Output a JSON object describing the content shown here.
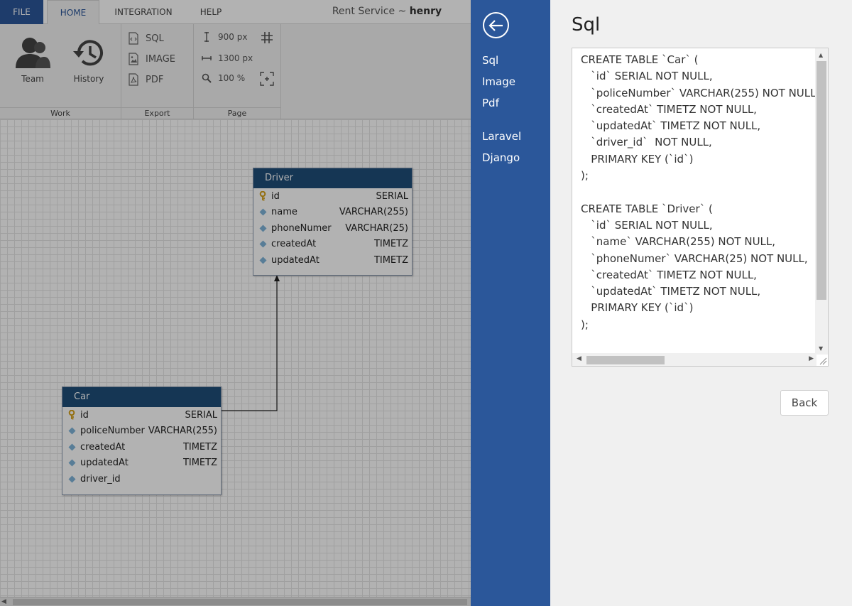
{
  "ribbon": {
    "tabs": {
      "file": "FILE",
      "home": "HOME",
      "integration": "INTEGRATION",
      "help": "HELP"
    },
    "title_prefix": "Rent Service ~ ",
    "title_user": "henry",
    "work": {
      "label": "Work",
      "team": "Team",
      "history": "History"
    },
    "export": {
      "label": "Export",
      "sql": "SQL",
      "image": "IMAGE",
      "pdf": "PDF"
    },
    "page": {
      "label": "Page",
      "height": "900 px",
      "width": "1300 px",
      "zoom": "100 %"
    }
  },
  "diagram": {
    "driver": {
      "name": "Driver",
      "columns": [
        {
          "name": "id",
          "type": "SERIAL",
          "key": "primary"
        },
        {
          "name": "name",
          "type": "VARCHAR(255)",
          "key": "field"
        },
        {
          "name": "phoneNumer",
          "type": "VARCHAR(25)",
          "key": "field"
        },
        {
          "name": "createdAt",
          "type": "TIMETZ",
          "key": "field"
        },
        {
          "name": "updatedAt",
          "type": "TIMETZ",
          "key": "field"
        }
      ]
    },
    "car": {
      "name": "Car",
      "columns": [
        {
          "name": "id",
          "type": "SERIAL",
          "key": "primary"
        },
        {
          "name": "policeNumber",
          "type": "VARCHAR(255)",
          "key": "field"
        },
        {
          "name": "createdAt",
          "type": "TIMETZ",
          "key": "field"
        },
        {
          "name": "updatedAt",
          "type": "TIMETZ",
          "key": "field"
        },
        {
          "name": "driver_id",
          "type": "",
          "key": "field"
        }
      ]
    }
  },
  "sidenav": {
    "items": [
      "Sql",
      "Image",
      "Pdf",
      "Laravel",
      "Django"
    ]
  },
  "panel": {
    "title": "Sql",
    "sql": "CREATE TABLE `Car` (\n   `id` SERIAL NOT NULL,\n   `policeNumber` VARCHAR(255) NOT NULL,\n   `createdAt` TIMETZ NOT NULL,\n   `updatedAt` TIMETZ NOT NULL,\n   `driver_id`  NOT NULL,\n   PRIMARY KEY (`id`)\n);\n\nCREATE TABLE `Driver` (\n   `id` SERIAL NOT NULL,\n   `name` VARCHAR(255) NOT NULL,\n   `phoneNumer` VARCHAR(25) NOT NULL,\n   `createdAt` TIMETZ NOT NULL,\n   `updatedAt` TIMETZ NOT NULL,\n   PRIMARY KEY (`id`)\n);",
    "back_label": "Back"
  },
  "colors": {
    "brand": "#2b579a",
    "entity_header": "#1f4e79",
    "primary_key": "#d4a017",
    "field_diamond": "#7fb3d8"
  }
}
